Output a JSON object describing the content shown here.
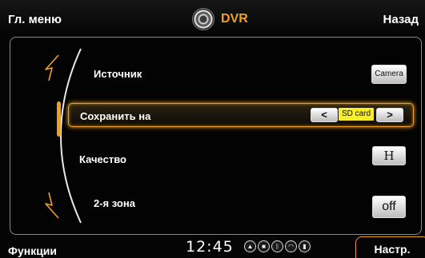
{
  "header": {
    "menu_label": "Гл. меню",
    "title": "DVR",
    "back_label": "Назад",
    "logo_icon": "camera-lens-icon"
  },
  "settings": {
    "rows": [
      {
        "label": "Источник",
        "control": "Camera"
      },
      {
        "label": "Сохранить на",
        "control": "SD card",
        "prev": "<",
        "next": ">"
      },
      {
        "label": "Качество",
        "control": "H"
      },
      {
        "label": "2-я зона",
        "control": "off"
      }
    ],
    "scroll_up_icon": "arrow-up-icon",
    "scroll_down_icon": "arrow-down-icon"
  },
  "footer": {
    "functions_tab": "Функции",
    "clock": "12:45",
    "settings_tab": "Настр.",
    "status_icons": [
      "navigation-icon",
      "camera-icon",
      "bluetooth-icon",
      "wifi-icon",
      "signal-icon"
    ]
  },
  "colors": {
    "accent": "#f0a020",
    "highlight_value": "#f6ee2a",
    "background": "#050505"
  }
}
